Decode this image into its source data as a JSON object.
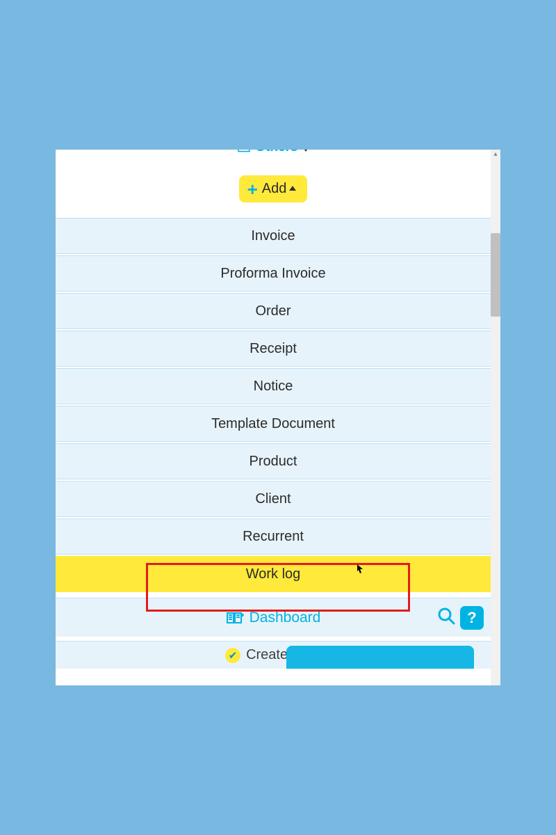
{
  "colors": {
    "accent": "#00b3e3",
    "highlight": "#ffe93b",
    "panel": "#e7f3fb",
    "border": "#bfe0f1",
    "danger": "#e41b1b"
  },
  "top": {
    "others_label": "Others",
    "icon": "folder-icon"
  },
  "add_button": {
    "label": "Add",
    "icon": "plus-icon"
  },
  "menu_items": [
    {
      "label": "Invoice",
      "highlight": false
    },
    {
      "label": "Proforma Invoice",
      "highlight": false
    },
    {
      "label": "Order",
      "highlight": false
    },
    {
      "label": "Receipt",
      "highlight": false
    },
    {
      "label": "Notice",
      "highlight": false
    },
    {
      "label": "Template Document",
      "highlight": false
    },
    {
      "label": "Product",
      "highlight": false
    },
    {
      "label": "Client",
      "highlight": false
    },
    {
      "label": "Recurrent",
      "highlight": false
    },
    {
      "label": "Work log",
      "highlight": true
    }
  ],
  "dashboard": {
    "label": "Dashboard",
    "icon": "book-icon",
    "search_icon": "search-icon",
    "help_icon": "help-icon",
    "help_text": "?"
  },
  "bottom": {
    "check_icon": "check-icon",
    "create_label": "Create acco",
    "blue_button_label": ""
  }
}
